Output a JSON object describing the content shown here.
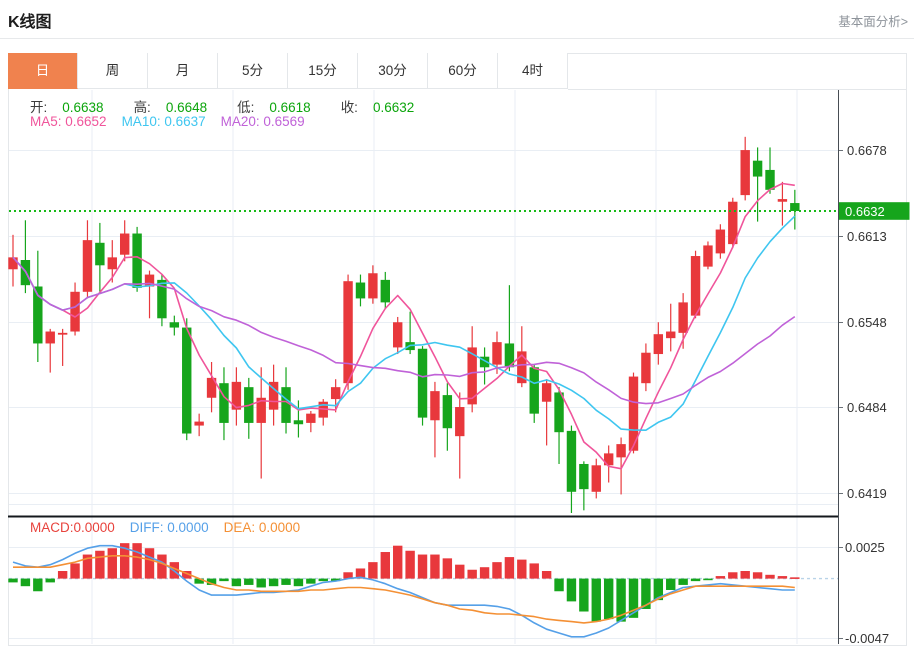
{
  "page": {
    "title": "K线图",
    "link": "基本面分析>"
  },
  "tabs": {
    "items": [
      "日",
      "周",
      "月",
      "5分",
      "15分",
      "30分",
      "60分",
      "4时"
    ],
    "active": "日"
  },
  "legend": {
    "ohlc": [
      {
        "label": "开:",
        "value": "0.6638"
      },
      {
        "label": "高:",
        "value": "0.6648"
      },
      {
        "label": "低:",
        "value": "0.6618"
      },
      {
        "label": "收:",
        "value": "0.6632"
      }
    ],
    "ma": [
      {
        "text": "MA5: 0.6652",
        "color": "#f0559b"
      },
      {
        "text": "MA10: 0.6637",
        "color": "#3fc6f0"
      },
      {
        "text": "MA20: 0.6569",
        "color": "#c062d8"
      }
    ],
    "macd": [
      {
        "text": "MACD:0.0000",
        "color": "#e8433d"
      },
      {
        "text": "DIFF: 0.0000",
        "color": "#55a0e8"
      },
      {
        "text": "DEA: 0.0000",
        "color": "#f49035"
      }
    ]
  },
  "axis": {
    "main_labels": [
      {
        "price": 0.6678,
        "text": "0.6678"
      },
      {
        "price": 0.6613,
        "text": "0.6613"
      },
      {
        "price": 0.6548,
        "text": "0.6548"
      },
      {
        "price": 0.6484,
        "text": "0.6484"
      },
      {
        "price": 0.6419,
        "text": "0.6419"
      }
    ],
    "current": {
      "price": 0.6632,
      "text": "0.6632"
    },
    "macd_labels": [
      {
        "value": 0.0025,
        "text": "0.0025"
      },
      {
        "value": -0.0047,
        "text": "-0.0047"
      }
    ]
  },
  "chart_data": {
    "type": "candlestick+macd",
    "note": "Daily K-line; red = up, green = down. MA5/MA10/MA20 overlays; MACD pane with DIFF/DEA lines.",
    "ylim_main": [
      0.6405,
      0.6705
    ],
    "ylim_macd": [
      -0.0052,
      0.0048
    ],
    "candles": {
      "open": [
        0.6588,
        0.6595,
        0.6575,
        0.6532,
        0.6539,
        0.6541,
        0.6571,
        0.6608,
        0.6588,
        0.6599,
        0.6615,
        0.6575,
        0.658,
        0.6548,
        0.6544,
        0.647,
        0.6491,
        0.6502,
        0.6482,
        0.6499,
        0.6472,
        0.6482,
        0.6499,
        0.6474,
        0.6472,
        0.6476,
        0.649,
        0.6502,
        0.6578,
        0.6566,
        0.658,
        0.6529,
        0.6533,
        0.6528,
        0.6474,
        0.6493,
        0.6462,
        0.6486,
        0.6522,
        0.6516,
        0.6532,
        0.6502,
        0.6514,
        0.6488,
        0.6495,
        0.6466,
        0.6441,
        0.642,
        0.644,
        0.6446,
        0.6451,
        0.6502,
        0.6524,
        0.6536,
        0.654,
        0.6553,
        0.659,
        0.66,
        0.6607,
        0.6644,
        0.667,
        0.6663,
        0.6639,
        0.6638
      ],
      "high": [
        0.6614,
        0.6625,
        0.6602,
        0.6543,
        0.6543,
        0.6578,
        0.6625,
        0.6623,
        0.661,
        0.6625,
        0.662,
        0.6587,
        0.6584,
        0.6553,
        0.6551,
        0.6479,
        0.6518,
        0.6514,
        0.6514,
        0.6506,
        0.6514,
        0.6516,
        0.6514,
        0.6489,
        0.6481,
        0.649,
        0.6505,
        0.6584,
        0.6584,
        0.6591,
        0.6586,
        0.6552,
        0.6556,
        0.653,
        0.6503,
        0.6502,
        0.6495,
        0.6545,
        0.6529,
        0.6541,
        0.6576,
        0.6545,
        0.6516,
        0.6505,
        0.6499,
        0.647,
        0.6443,
        0.6445,
        0.6455,
        0.6461,
        0.651,
        0.6532,
        0.6548,
        0.6562,
        0.657,
        0.6602,
        0.6609,
        0.6622,
        0.6642,
        0.6688,
        0.668,
        0.668,
        0.6654,
        0.6648
      ],
      "low": [
        0.6575,
        0.657,
        0.6518,
        0.651,
        0.6515,
        0.6538,
        0.6566,
        0.6571,
        0.6578,
        0.6594,
        0.6571,
        0.6551,
        0.6545,
        0.6538,
        0.6459,
        0.6462,
        0.648,
        0.6459,
        0.647,
        0.646,
        0.643,
        0.647,
        0.6464,
        0.6461,
        0.6465,
        0.647,
        0.648,
        0.6497,
        0.656,
        0.6562,
        0.6558,
        0.6524,
        0.6524,
        0.647,
        0.6446,
        0.6451,
        0.643,
        0.648,
        0.6501,
        0.6509,
        0.6511,
        0.6499,
        0.6472,
        0.6455,
        0.6441,
        0.6404,
        0.6406,
        0.6415,
        0.6427,
        0.6418,
        0.6449,
        0.6496,
        0.6516,
        0.6526,
        0.6528,
        0.6551,
        0.6588,
        0.6596,
        0.6604,
        0.664,
        0.6624,
        0.6645,
        0.6621,
        0.6618
      ],
      "close": [
        0.6597,
        0.6576,
        0.6532,
        0.6541,
        0.654,
        0.6571,
        0.661,
        0.6591,
        0.6597,
        0.6615,
        0.6574,
        0.6584,
        0.6551,
        0.6544,
        0.6464,
        0.6473,
        0.6506,
        0.6472,
        0.6503,
        0.6472,
        0.6491,
        0.6503,
        0.6472,
        0.6471,
        0.6479,
        0.6488,
        0.6499,
        0.6579,
        0.6566,
        0.6585,
        0.6563,
        0.6548,
        0.6527,
        0.6476,
        0.6496,
        0.6468,
        0.6484,
        0.6529,
        0.6514,
        0.6533,
        0.6514,
        0.6526,
        0.6479,
        0.6502,
        0.6465,
        0.642,
        0.6422,
        0.644,
        0.6449,
        0.6456,
        0.6507,
        0.6525,
        0.6539,
        0.6541,
        0.6563,
        0.6598,
        0.6606,
        0.6618,
        0.6639,
        0.6678,
        0.6658,
        0.6648,
        0.6641,
        0.6632
      ]
    },
    "ma_periods": [
      5,
      10,
      20
    ],
    "macd": {
      "hist": [
        -0.0003,
        -0.0006,
        -0.001,
        -0.0003,
        0.0006,
        0.0012,
        0.0019,
        0.0022,
        0.0024,
        0.0028,
        0.0028,
        0.0024,
        0.0019,
        0.0013,
        0.0006,
        -0.0004,
        -0.0005,
        -0.0002,
        -0.0006,
        -0.0005,
        -0.0007,
        -0.0006,
        -0.0005,
        -0.0006,
        -0.0004,
        -0.0002,
        -0.0002,
        0.0005,
        0.0008,
        0.0013,
        0.0021,
        0.0026,
        0.0022,
        0.0019,
        0.0019,
        0.0016,
        0.0011,
        0.0007,
        0.0009,
        0.0013,
        0.0017,
        0.0015,
        0.0012,
        0.0006,
        -0.001,
        -0.0018,
        -0.0026,
        -0.0034,
        -0.0032,
        -0.0034,
        -0.0031,
        -0.0024,
        -0.0017,
        -0.0009,
        -0.0005,
        -0.0002,
        -0.0001,
        0.0002,
        0.0005,
        0.0006,
        0.0005,
        0.0003,
        0.0002,
        0.0001
      ],
      "diff": [
        0.0013,
        0.001,
        0.0009,
        0.0011,
        0.0015,
        0.002,
        0.0024,
        0.0026,
        0.0026,
        0.0024,
        0.0021,
        0.0017,
        0.0013,
        0.0006,
        -0.0002,
        -0.0009,
        -0.0013,
        -0.0013,
        -0.0013,
        -0.0012,
        -0.0011,
        -0.0011,
        -0.001,
        -0.0009,
        -0.0006,
        -0.0003,
        -0.0002,
        0.0,
        0.0001,
        -0.0001,
        -0.0004,
        -0.0008,
        -0.0011,
        -0.0015,
        -0.0019,
        -0.0021,
        -0.0021,
        -0.0021,
        -0.0021,
        -0.0022,
        -0.0024,
        -0.0029,
        -0.0035,
        -0.004,
        -0.0043,
        -0.0046,
        -0.0046,
        -0.0043,
        -0.0039,
        -0.0033,
        -0.0027,
        -0.0021,
        -0.0015,
        -0.0011,
        -0.0007,
        -0.0006,
        -0.0005,
        -0.0004,
        -0.0005,
        -0.0006,
        -0.0007,
        -0.0008,
        -0.0009,
        -0.0009
      ],
      "dea": [
        0.0009,
        0.0009,
        0.0009,
        0.0009,
        0.0011,
        0.0013,
        0.0016,
        0.0017,
        0.0018,
        0.0018,
        0.0017,
        0.0015,
        0.0012,
        0.0008,
        0.0004,
        0.0,
        -0.0004,
        -0.0007,
        -0.0009,
        -0.0009,
        -0.001,
        -0.001,
        -0.001,
        -0.001,
        -0.0009,
        -0.0009,
        -0.0008,
        -0.0007,
        -0.0007,
        -0.0008,
        -0.0009,
        -0.0011,
        -0.0013,
        -0.0016,
        -0.0019,
        -0.0021,
        -0.0024,
        -0.0025,
        -0.0027,
        -0.0028,
        -0.0028,
        -0.0029,
        -0.003,
        -0.0032,
        -0.0033,
        -0.0034,
        -0.0035,
        -0.0034,
        -0.0032,
        -0.0029,
        -0.0025,
        -0.0021,
        -0.0016,
        -0.0012,
        -0.0009,
        -0.0006,
        -0.0006,
        -0.0006,
        -0.0006,
        -0.0006,
        -0.0006,
        -0.0006,
        -0.0006,
        -0.0007
      ]
    },
    "colors": {
      "up": "#e8383c",
      "down": "#16a51c",
      "value_text": "#0ca50c",
      "ma5": "#f0559b",
      "ma10": "#3fc6f0",
      "ma20": "#c062d8",
      "diff": "#55a0e8",
      "dea": "#f49035",
      "current_line": "#18b918",
      "tab_active": "#f0824e"
    }
  }
}
